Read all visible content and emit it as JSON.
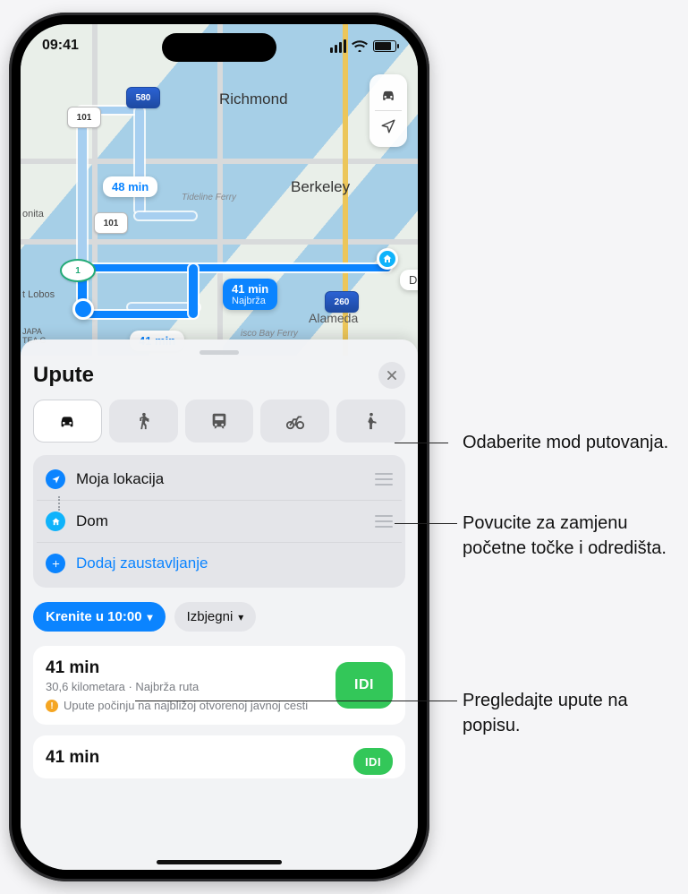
{
  "statusbar": {
    "time": "09:41"
  },
  "map": {
    "cities": {
      "richmond": "Richmond",
      "berkeley": "Berkeley",
      "alameda": "Alameda"
    },
    "small_labels": {
      "ptlobos": "t Lobos",
      "bonita": "onita",
      "japantea": "JAPA\nTEA G",
      "tideline": "Tideline Ferry",
      "sfbayferry": "isco Bay Ferry"
    },
    "shields": {
      "i101a": "101",
      "i101b": "101",
      "i580": "580",
      "i260": "260",
      "ca1": "1"
    },
    "bubbles": {
      "alt1": "48 min",
      "alt2": "41 min",
      "primary_time": "41 min",
      "primary_sub": "Najbrža",
      "dest": "Dom"
    }
  },
  "sheet": {
    "title": "Upute",
    "modes": [
      "driving",
      "walking",
      "transit",
      "cycling",
      "rideshare"
    ],
    "stops": {
      "from": "Moja lokacija",
      "to": "Dom",
      "add": "Dodaj zaustavljanje"
    },
    "options": {
      "depart": "Krenite u 10:00",
      "avoid": "Izbjegni"
    },
    "routes": [
      {
        "time": "41 min",
        "sub": "30,6 kilometara · Najbrža ruta",
        "warn": "Upute počinju na najbližoj otvorenoj javnoj cesti",
        "go": "IDI"
      },
      {
        "time": "41 min",
        "sub": "",
        "warn": "",
        "go": "IDI"
      }
    ]
  },
  "callouts": {
    "modes": "Odaberite mod putovanja.",
    "drag": "Povucite za zamjenu početne točke i odredišta.",
    "list": "Pregledajte upute na popisu."
  }
}
